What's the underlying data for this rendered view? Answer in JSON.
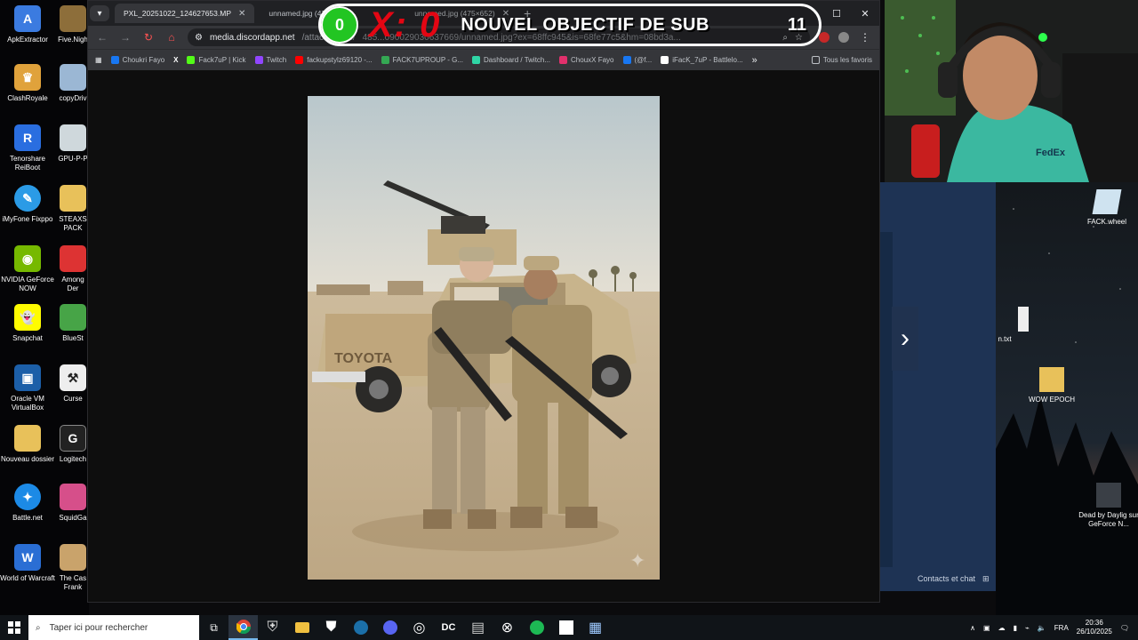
{
  "desktop": {
    "icons": [
      {
        "label": "ApkExtractor",
        "color": "#3b7be0"
      },
      {
        "label": "ClashRoyale",
        "color": "#e0a23b"
      },
      {
        "label": "Tenorshare ReiBoot",
        "color": "#2a6ee0"
      },
      {
        "label": "iMyFone Fixppo",
        "color": "#2b9be6"
      },
      {
        "label": "NVIDIA GeForce NOW",
        "color": "#76b900"
      },
      {
        "label": "Snapchat",
        "color": "#fffc00"
      },
      {
        "label": "Oracle VM VirtualBox",
        "color": "#1c5fa8"
      },
      {
        "label": "Nouveau dossier",
        "color": "#e8c15a"
      },
      {
        "label": "Battle.net",
        "color": "#1c8ae6"
      },
      {
        "label": "World of Warcraft",
        "color": "#2a6ed4"
      }
    ],
    "icons_col2": [
      {
        "label": "Five.Nigh",
        "color": "#8d6e3a"
      },
      {
        "label": "copyDriv",
        "color": "#9bb7d4"
      },
      {
        "label": "GPU-P-P",
        "color": "#cfd8dc"
      },
      {
        "label": "STEAXS PACK",
        "color": "#e8c15a"
      },
      {
        "label": "Among Der",
        "color": "#d33"
      },
      {
        "label": "BlueSt",
        "color": "#47a447"
      },
      {
        "label": "Curse",
        "color": "#eee"
      },
      {
        "label": "Logitech",
        "color": "#222"
      },
      {
        "label": "SquidGa",
        "color": "#d64f8a"
      },
      {
        "label": "The Cas Frank",
        "color": "#c9a36b"
      }
    ]
  },
  "browser": {
    "tabs": [
      {
        "label": "PXL_20251022_124627653.MP",
        "active": true
      },
      {
        "label": "unnamed.jpg (47",
        "active": false
      },
      {
        "label": "unnamed.jpg (475×652)",
        "active": false
      }
    ],
    "url_host": "media.discordapp.net",
    "url_path": "/attachments/",
    "url_rest": "485...090029030637669/unnamed.jpg?ex=68ffc945&is=68fe77c5&hm=08bd3a...",
    "bookmarks": [
      {
        "label": "Choukri Fayo",
        "color": "#1877f2"
      },
      {
        "label": "",
        "color": "#ffffff"
      },
      {
        "label": "Fack7uP | Kick",
        "color": "#53fc18"
      },
      {
        "label": "Twitch",
        "color": "#9146ff"
      },
      {
        "label": "fackupstylz69120 -...",
        "color": "#ff0000"
      },
      {
        "label": "FACK7UPROUP - G...",
        "color": "#34a853"
      },
      {
        "label": "Dashboard / Twitch...",
        "color": "#2fd5a5"
      },
      {
        "label": "ChouxX Fayo",
        "color": "#e1306c"
      },
      {
        "label": "(@f...",
        "color": "#1877f2"
      },
      {
        "label": "iFacK_7uP - Battlelo...",
        "color": "#ffffff"
      }
    ],
    "bookmarks_more": "»",
    "all_favorites": "Tous les favoris"
  },
  "overlay": {
    "current": "0",
    "x_label": "X: 0",
    "title": "NOUVEL OBJECTIF DE SUB",
    "goal": "11",
    "sub_current": 0,
    "sub_goal": 11
  },
  "sidepanel": {
    "contacts": "Contacts et chat",
    "next": "›"
  },
  "wallpaper_icons": [
    {
      "label": "FACK.wheel"
    },
    {
      "label": "n.txt"
    },
    {
      "label": "WOW EPOCH"
    },
    {
      "label": "Dead by Daylig sur GeForce N..."
    }
  ],
  "taskbar": {
    "search_placeholder": "Taper ici pour rechercher",
    "lang": "FRA",
    "time": "20:36",
    "date": "26/10/2025"
  },
  "colors": {
    "accent_green": "#22c522",
    "accent_red": "#e30613",
    "chrome_dark": "#202124"
  }
}
